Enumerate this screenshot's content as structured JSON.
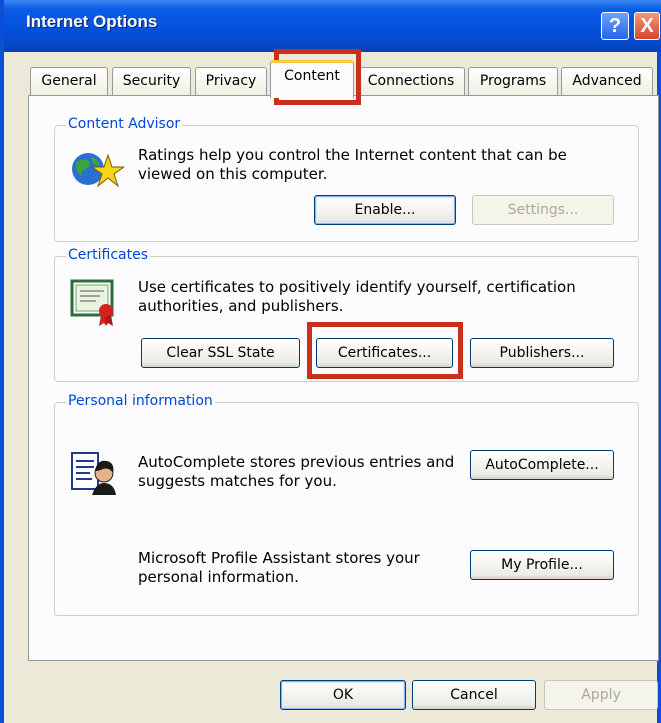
{
  "window": {
    "title": "Internet Options"
  },
  "titlebar_buttons": {
    "help": "?",
    "close": "X"
  },
  "tabs": [
    {
      "label": "General"
    },
    {
      "label": "Security"
    },
    {
      "label": "Privacy"
    },
    {
      "label": "Content",
      "active": true
    },
    {
      "label": "Connections"
    },
    {
      "label": "Programs"
    },
    {
      "label": "Advanced"
    }
  ],
  "content_advisor": {
    "legend": "Content Advisor",
    "description": "Ratings help you control the Internet content that can be viewed on this computer.",
    "enable_label": "Enable...",
    "settings_label": "Settings...",
    "icon": "globe-star-icon"
  },
  "certificates": {
    "legend": "Certificates",
    "description": "Use certificates to positively identify yourself, certification authorities, and publishers.",
    "clear_ssl_label": "Clear SSL State",
    "certificates_label": "Certificates...",
    "publishers_label": "Publishers...",
    "icon": "certificate-icon"
  },
  "personal_information": {
    "legend": "Personal information",
    "autocomplete_description": "AutoComplete stores previous entries and suggests matches for you.",
    "autocomplete_label": "AutoComplete...",
    "profile_description": "Microsoft Profile Assistant stores your personal information.",
    "my_profile_label": "My Profile...",
    "icon": "profile-assistant-icon"
  },
  "footer": {
    "ok_label": "OK",
    "cancel_label": "Cancel",
    "apply_label": "Apply"
  },
  "colors": {
    "titlebar": "#0553de",
    "highlight": "#c8301c",
    "legend_text": "#0046d5",
    "dialog_bg": "#ece9d8"
  }
}
